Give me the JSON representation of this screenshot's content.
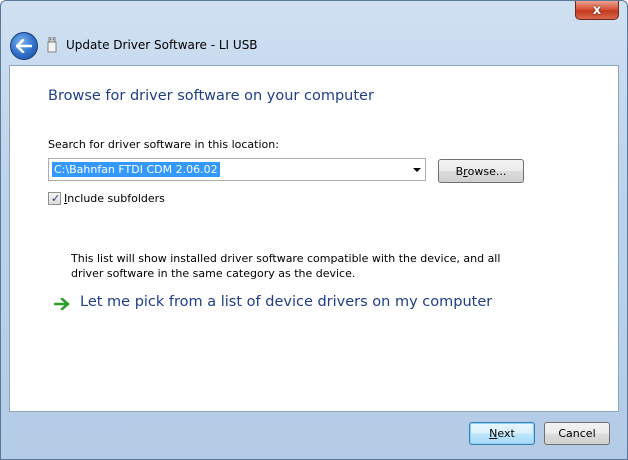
{
  "window": {
    "title": "Update Driver Software - LI USB",
    "close_glyph": "x",
    "icons": {
      "back": "back-arrow-icon",
      "usb": "usb-device-icon",
      "close": "close-icon",
      "pick": "green-arrow-icon"
    },
    "colors": {
      "heading": "#1e3f87",
      "selection": "#3399ff",
      "close_button": "#d9553a"
    }
  },
  "main": {
    "heading": "Browse for driver software on your computer",
    "search_label": "Search for driver software in this location:",
    "path_value": "C:\\Bahnfan FTDI CDM 2.06.02",
    "browse_label_pre": "B",
    "browse_label_key": "r",
    "browse_label_post": "owse...",
    "include_key": "I",
    "include_label_post": "nclude subfolders",
    "include_checked": true,
    "pick_link": "Let me pick from a list of device drivers on my computer",
    "pick_description": "This list will show installed driver software compatible with the device, and all driver software in the same category as the device."
  },
  "footer": {
    "next_key": "N",
    "next_post": "ext",
    "cancel_label": "Cancel"
  }
}
